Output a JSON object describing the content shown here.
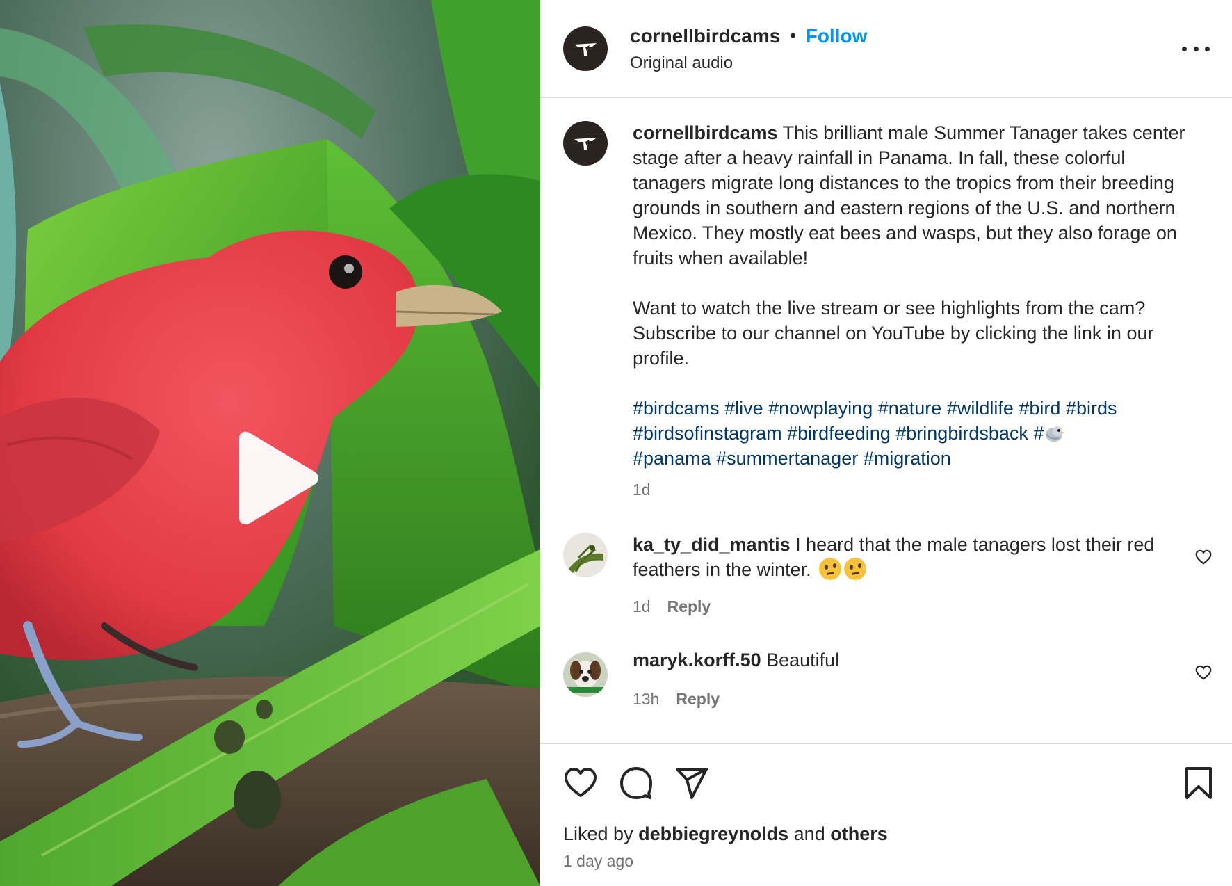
{
  "media": {
    "type": "video",
    "play_icon": "play-icon"
  },
  "header": {
    "username": "cornellbirdcams",
    "separator": "•",
    "follow_label": "Follow",
    "subtitle": "Original audio",
    "more_icon": "more-horizontal-icon"
  },
  "caption": {
    "username": "cornellbirdcams",
    "paragraph1": "This brilliant male Summer Tanager takes center stage after a heavy rainfall in Panama. In fall, these colorful tanagers migrate long distances to the tropics from their breeding grounds in southern and eastern regions of the U.S. and northern Mexico. They mostly eat bees and wasps, but they also forage on fruits when available!",
    "paragraph2": "Want to watch the live stream or see highlights from the cam? Subscribe to our channel on YouTube by clicking the link in our profile.",
    "hashtags": [
      "#birdcams",
      "#live",
      "#nowplaying",
      "#nature",
      "#wildlife",
      "#bird",
      "#birds",
      "#birdsofinstagram",
      "#birdfeeding",
      "#bringbirdsback",
      "#",
      "#panama",
      "#summertanager",
      "#migration"
    ],
    "time": "1d"
  },
  "comments": [
    {
      "username": "ka_ty_did_mantis",
      "text": "I heard that the male tanagers lost their red feathers in the winter.",
      "emoji": "thinking-face-emoji x2",
      "time": "1d",
      "reply_label": "Reply"
    },
    {
      "username": "maryk.korff.50",
      "text": "Beautiful",
      "time": "13h",
      "reply_label": "Reply"
    }
  ],
  "actions": {
    "icons": [
      "heart-icon",
      "comment-icon",
      "share-icon",
      "bookmark-icon"
    ],
    "liked_by_prefix": "Liked by",
    "liked_by_user": "debbiegreynolds",
    "liked_by_and": "and",
    "liked_by_others": "others",
    "post_time": "1 day ago"
  },
  "colors": {
    "link_blue": "#0095f6",
    "hashtag_blue": "#00376b",
    "muted_text": "#737373",
    "divider": "#dbdbdb"
  }
}
